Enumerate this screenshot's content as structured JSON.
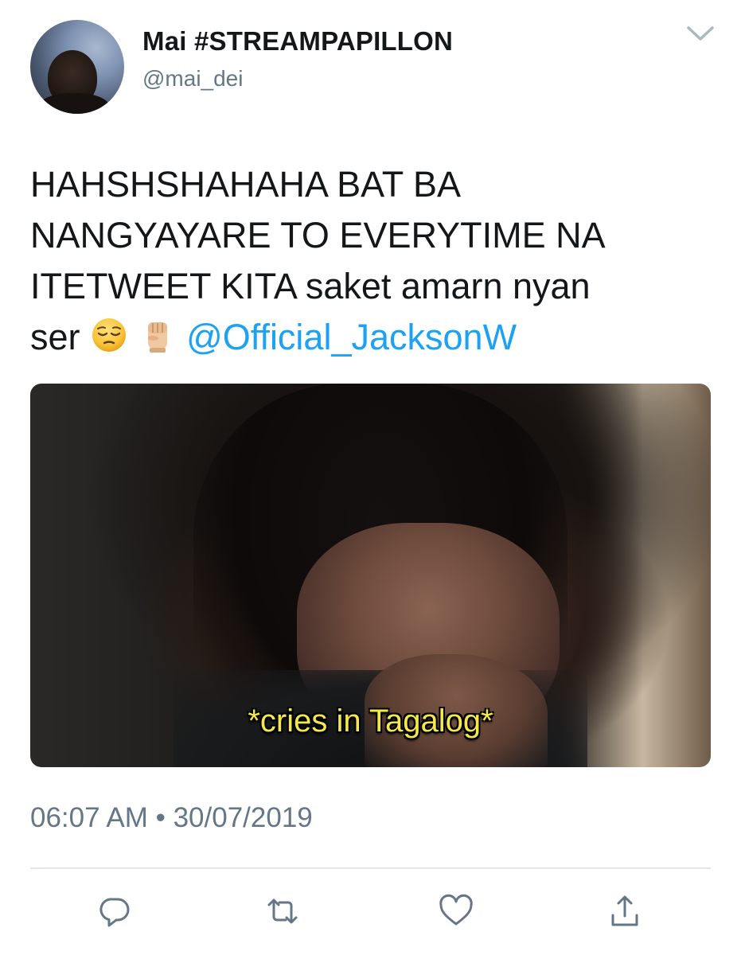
{
  "tweet": {
    "author": {
      "display_name": "Mai #STREAMPAPILLON",
      "handle": "@mai_dei"
    },
    "text": {
      "line1": "HAHSHSHAHAHA BAT BA",
      "line2": "NANGYAYARE TO EVERYTIME NA",
      "line3": "ITETWEET KITA saket amarn nyan",
      "line4_prefix": "ser",
      "mention": "@Official_JacksonW"
    },
    "media": {
      "caption": "*cries in Tagalog*"
    },
    "timestamp": "06:07 AM • 30/07/2019"
  },
  "icons": {
    "menu": "chevron-down-icon",
    "emoji_1": "pensive-face-emoji",
    "emoji_2": "raised-fist-emoji",
    "reply": "reply-icon",
    "retweet": "retweet-icon",
    "like": "like-icon",
    "share": "share-icon"
  },
  "colors": {
    "mention": "#1da1f2",
    "secondary_text": "#657786",
    "divider": "#e1e8ed",
    "caption": "#f5e94a"
  }
}
